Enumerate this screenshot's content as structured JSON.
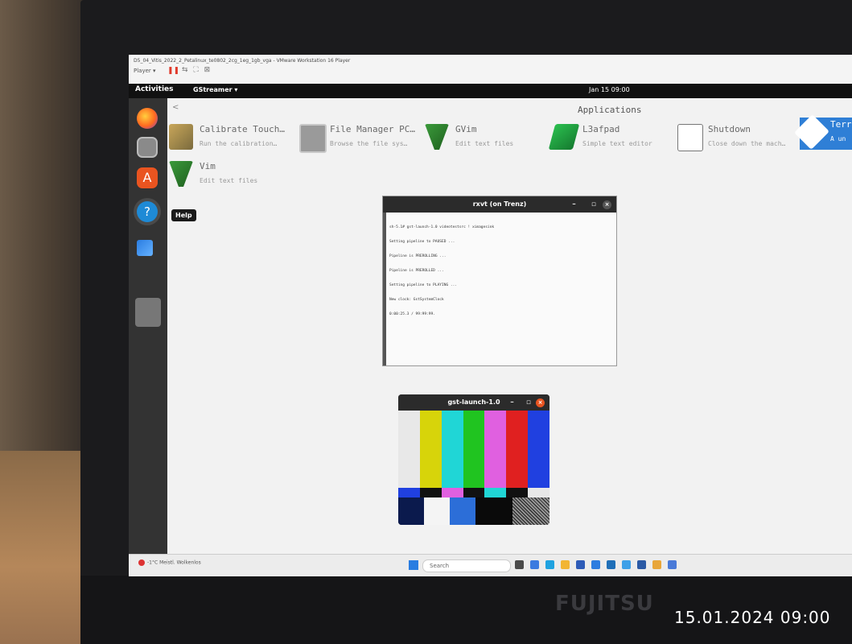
{
  "vm": {
    "title": "D5_04_Vitis_2022_2_Petalinux_te0802_2cg_1eg_1gb_vga - VMware Workstation 16 Player",
    "player_menu": "Player ▾",
    "pause_icon": "pause-icon",
    "tools": "⇆ ⛶ ⊠"
  },
  "topbar": {
    "activities": "Activities",
    "app_menu": "GStreamer ▾",
    "clock": "Jan 15 09:00"
  },
  "dock": {
    "items": [
      "firefox-icon",
      "files-icon",
      "software-store-icon",
      "help-icon",
      "network-icon"
    ],
    "help_tooltip": "Help",
    "show_apps": "⠿"
  },
  "desktop": {
    "back": "<",
    "apps_title": "Applications",
    "apps": [
      {
        "name": "Calibrate Touch…",
        "desc": "Run the calibration…"
      },
      {
        "name": "File Manager PC…",
        "desc": "Browse the file sys…"
      },
      {
        "name": "GVim",
        "desc": "Edit text files"
      },
      {
        "name": "L3afpad",
        "desc": "Simple text editor"
      },
      {
        "name": "Shutdown",
        "desc": "Close down the mach…"
      },
      {
        "name": "Terr",
        "desc": "A un"
      },
      {
        "name": "Vim",
        "desc": "Edit text files"
      }
    ]
  },
  "rxvt": {
    "title": "rxvt (on Trenz)",
    "controls": "– ▫",
    "close": "×",
    "lines": [
      "sh-5.1# gst-launch-1.0 videotestsrc ! ximagesink",
      "Setting pipeline to PAUSED ...",
      "Pipeline is PREROLLING ...",
      "Pipeline is PREROLLED ...",
      "Setting pipeline to PLAYING ...",
      "New clock: GstSystemClock",
      "0:00:25.3 / 99:99:99."
    ]
  },
  "gst": {
    "title": "gst-launch-1.0",
    "controls": "– ▫",
    "close": "×",
    "top_colors": [
      "#e8e8e8",
      "#d7d40a",
      "#20d6d6",
      "#20c420",
      "#e060e0",
      "#e02020",
      "#2040e0"
    ],
    "mid_colors": [
      "#2040e0",
      "#111111",
      "#e060e0",
      "#111111",
      "#20d6d6",
      "#111111",
      "#e8e8e8"
    ],
    "low_colors": [
      "#0b1a4d",
      "#f4f4f4",
      "#2c6ed8",
      "#0a0a0a",
      "#0a0a0a"
    ]
  },
  "taskbar": {
    "weather": "-1°C",
    "weather_sub": "Meistl. Wolkenlos",
    "search": "Search",
    "icons": [
      "#4a4a4a",
      "#3b7be0",
      "#1fa2e0",
      "#f2b534",
      "#2d5bb8",
      "#2d7de0",
      "#1f6fb8",
      "#3da0e8",
      "#2b5aa5",
      "#e8a63a",
      "#4a7ad8"
    ]
  },
  "photo": {
    "brand": "FUJITSU",
    "timestamp": "15.01.2024  09:00"
  }
}
